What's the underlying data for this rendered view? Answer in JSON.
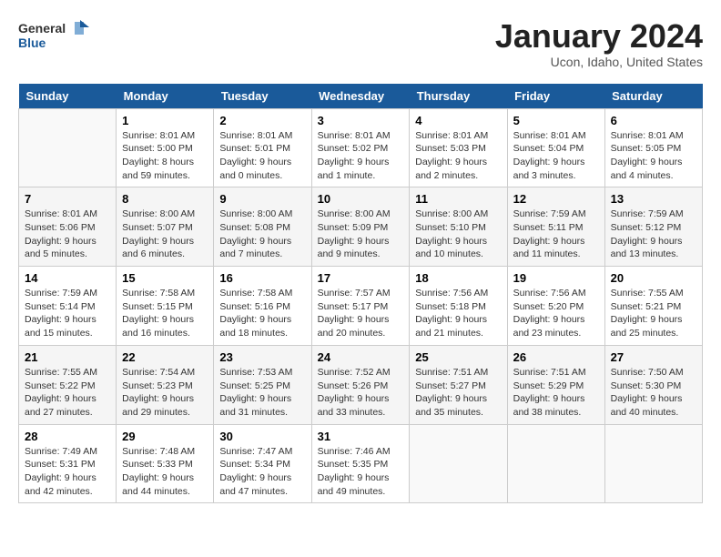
{
  "header": {
    "logo_line1": "General",
    "logo_line2": "Blue",
    "month": "January 2024",
    "location": "Ucon, Idaho, United States"
  },
  "days_of_week": [
    "Sunday",
    "Monday",
    "Tuesday",
    "Wednesday",
    "Thursday",
    "Friday",
    "Saturday"
  ],
  "weeks": [
    [
      {
        "day": "",
        "info": ""
      },
      {
        "day": "1",
        "info": "Sunrise: 8:01 AM\nSunset: 5:00 PM\nDaylight: 8 hours\nand 59 minutes."
      },
      {
        "day": "2",
        "info": "Sunrise: 8:01 AM\nSunset: 5:01 PM\nDaylight: 9 hours\nand 0 minutes."
      },
      {
        "day": "3",
        "info": "Sunrise: 8:01 AM\nSunset: 5:02 PM\nDaylight: 9 hours\nand 1 minute."
      },
      {
        "day": "4",
        "info": "Sunrise: 8:01 AM\nSunset: 5:03 PM\nDaylight: 9 hours\nand 2 minutes."
      },
      {
        "day": "5",
        "info": "Sunrise: 8:01 AM\nSunset: 5:04 PM\nDaylight: 9 hours\nand 3 minutes."
      },
      {
        "day": "6",
        "info": "Sunrise: 8:01 AM\nSunset: 5:05 PM\nDaylight: 9 hours\nand 4 minutes."
      }
    ],
    [
      {
        "day": "7",
        "info": "Sunrise: 8:01 AM\nSunset: 5:06 PM\nDaylight: 9 hours\nand 5 minutes."
      },
      {
        "day": "8",
        "info": "Sunrise: 8:00 AM\nSunset: 5:07 PM\nDaylight: 9 hours\nand 6 minutes."
      },
      {
        "day": "9",
        "info": "Sunrise: 8:00 AM\nSunset: 5:08 PM\nDaylight: 9 hours\nand 7 minutes."
      },
      {
        "day": "10",
        "info": "Sunrise: 8:00 AM\nSunset: 5:09 PM\nDaylight: 9 hours\nand 9 minutes."
      },
      {
        "day": "11",
        "info": "Sunrise: 8:00 AM\nSunset: 5:10 PM\nDaylight: 9 hours\nand 10 minutes."
      },
      {
        "day": "12",
        "info": "Sunrise: 7:59 AM\nSunset: 5:11 PM\nDaylight: 9 hours\nand 11 minutes."
      },
      {
        "day": "13",
        "info": "Sunrise: 7:59 AM\nSunset: 5:12 PM\nDaylight: 9 hours\nand 13 minutes."
      }
    ],
    [
      {
        "day": "14",
        "info": "Sunrise: 7:59 AM\nSunset: 5:14 PM\nDaylight: 9 hours\nand 15 minutes."
      },
      {
        "day": "15",
        "info": "Sunrise: 7:58 AM\nSunset: 5:15 PM\nDaylight: 9 hours\nand 16 minutes."
      },
      {
        "day": "16",
        "info": "Sunrise: 7:58 AM\nSunset: 5:16 PM\nDaylight: 9 hours\nand 18 minutes."
      },
      {
        "day": "17",
        "info": "Sunrise: 7:57 AM\nSunset: 5:17 PM\nDaylight: 9 hours\nand 20 minutes."
      },
      {
        "day": "18",
        "info": "Sunrise: 7:56 AM\nSunset: 5:18 PM\nDaylight: 9 hours\nand 21 minutes."
      },
      {
        "day": "19",
        "info": "Sunrise: 7:56 AM\nSunset: 5:20 PM\nDaylight: 9 hours\nand 23 minutes."
      },
      {
        "day": "20",
        "info": "Sunrise: 7:55 AM\nSunset: 5:21 PM\nDaylight: 9 hours\nand 25 minutes."
      }
    ],
    [
      {
        "day": "21",
        "info": "Sunrise: 7:55 AM\nSunset: 5:22 PM\nDaylight: 9 hours\nand 27 minutes."
      },
      {
        "day": "22",
        "info": "Sunrise: 7:54 AM\nSunset: 5:23 PM\nDaylight: 9 hours\nand 29 minutes."
      },
      {
        "day": "23",
        "info": "Sunrise: 7:53 AM\nSunset: 5:25 PM\nDaylight: 9 hours\nand 31 minutes."
      },
      {
        "day": "24",
        "info": "Sunrise: 7:52 AM\nSunset: 5:26 PM\nDaylight: 9 hours\nand 33 minutes."
      },
      {
        "day": "25",
        "info": "Sunrise: 7:51 AM\nSunset: 5:27 PM\nDaylight: 9 hours\nand 35 minutes."
      },
      {
        "day": "26",
        "info": "Sunrise: 7:51 AM\nSunset: 5:29 PM\nDaylight: 9 hours\nand 38 minutes."
      },
      {
        "day": "27",
        "info": "Sunrise: 7:50 AM\nSunset: 5:30 PM\nDaylight: 9 hours\nand 40 minutes."
      }
    ],
    [
      {
        "day": "28",
        "info": "Sunrise: 7:49 AM\nSunset: 5:31 PM\nDaylight: 9 hours\nand 42 minutes."
      },
      {
        "day": "29",
        "info": "Sunrise: 7:48 AM\nSunset: 5:33 PM\nDaylight: 9 hours\nand 44 minutes."
      },
      {
        "day": "30",
        "info": "Sunrise: 7:47 AM\nSunset: 5:34 PM\nDaylight: 9 hours\nand 47 minutes."
      },
      {
        "day": "31",
        "info": "Sunrise: 7:46 AM\nSunset: 5:35 PM\nDaylight: 9 hours\nand 49 minutes."
      },
      {
        "day": "",
        "info": ""
      },
      {
        "day": "",
        "info": ""
      },
      {
        "day": "",
        "info": ""
      }
    ]
  ]
}
